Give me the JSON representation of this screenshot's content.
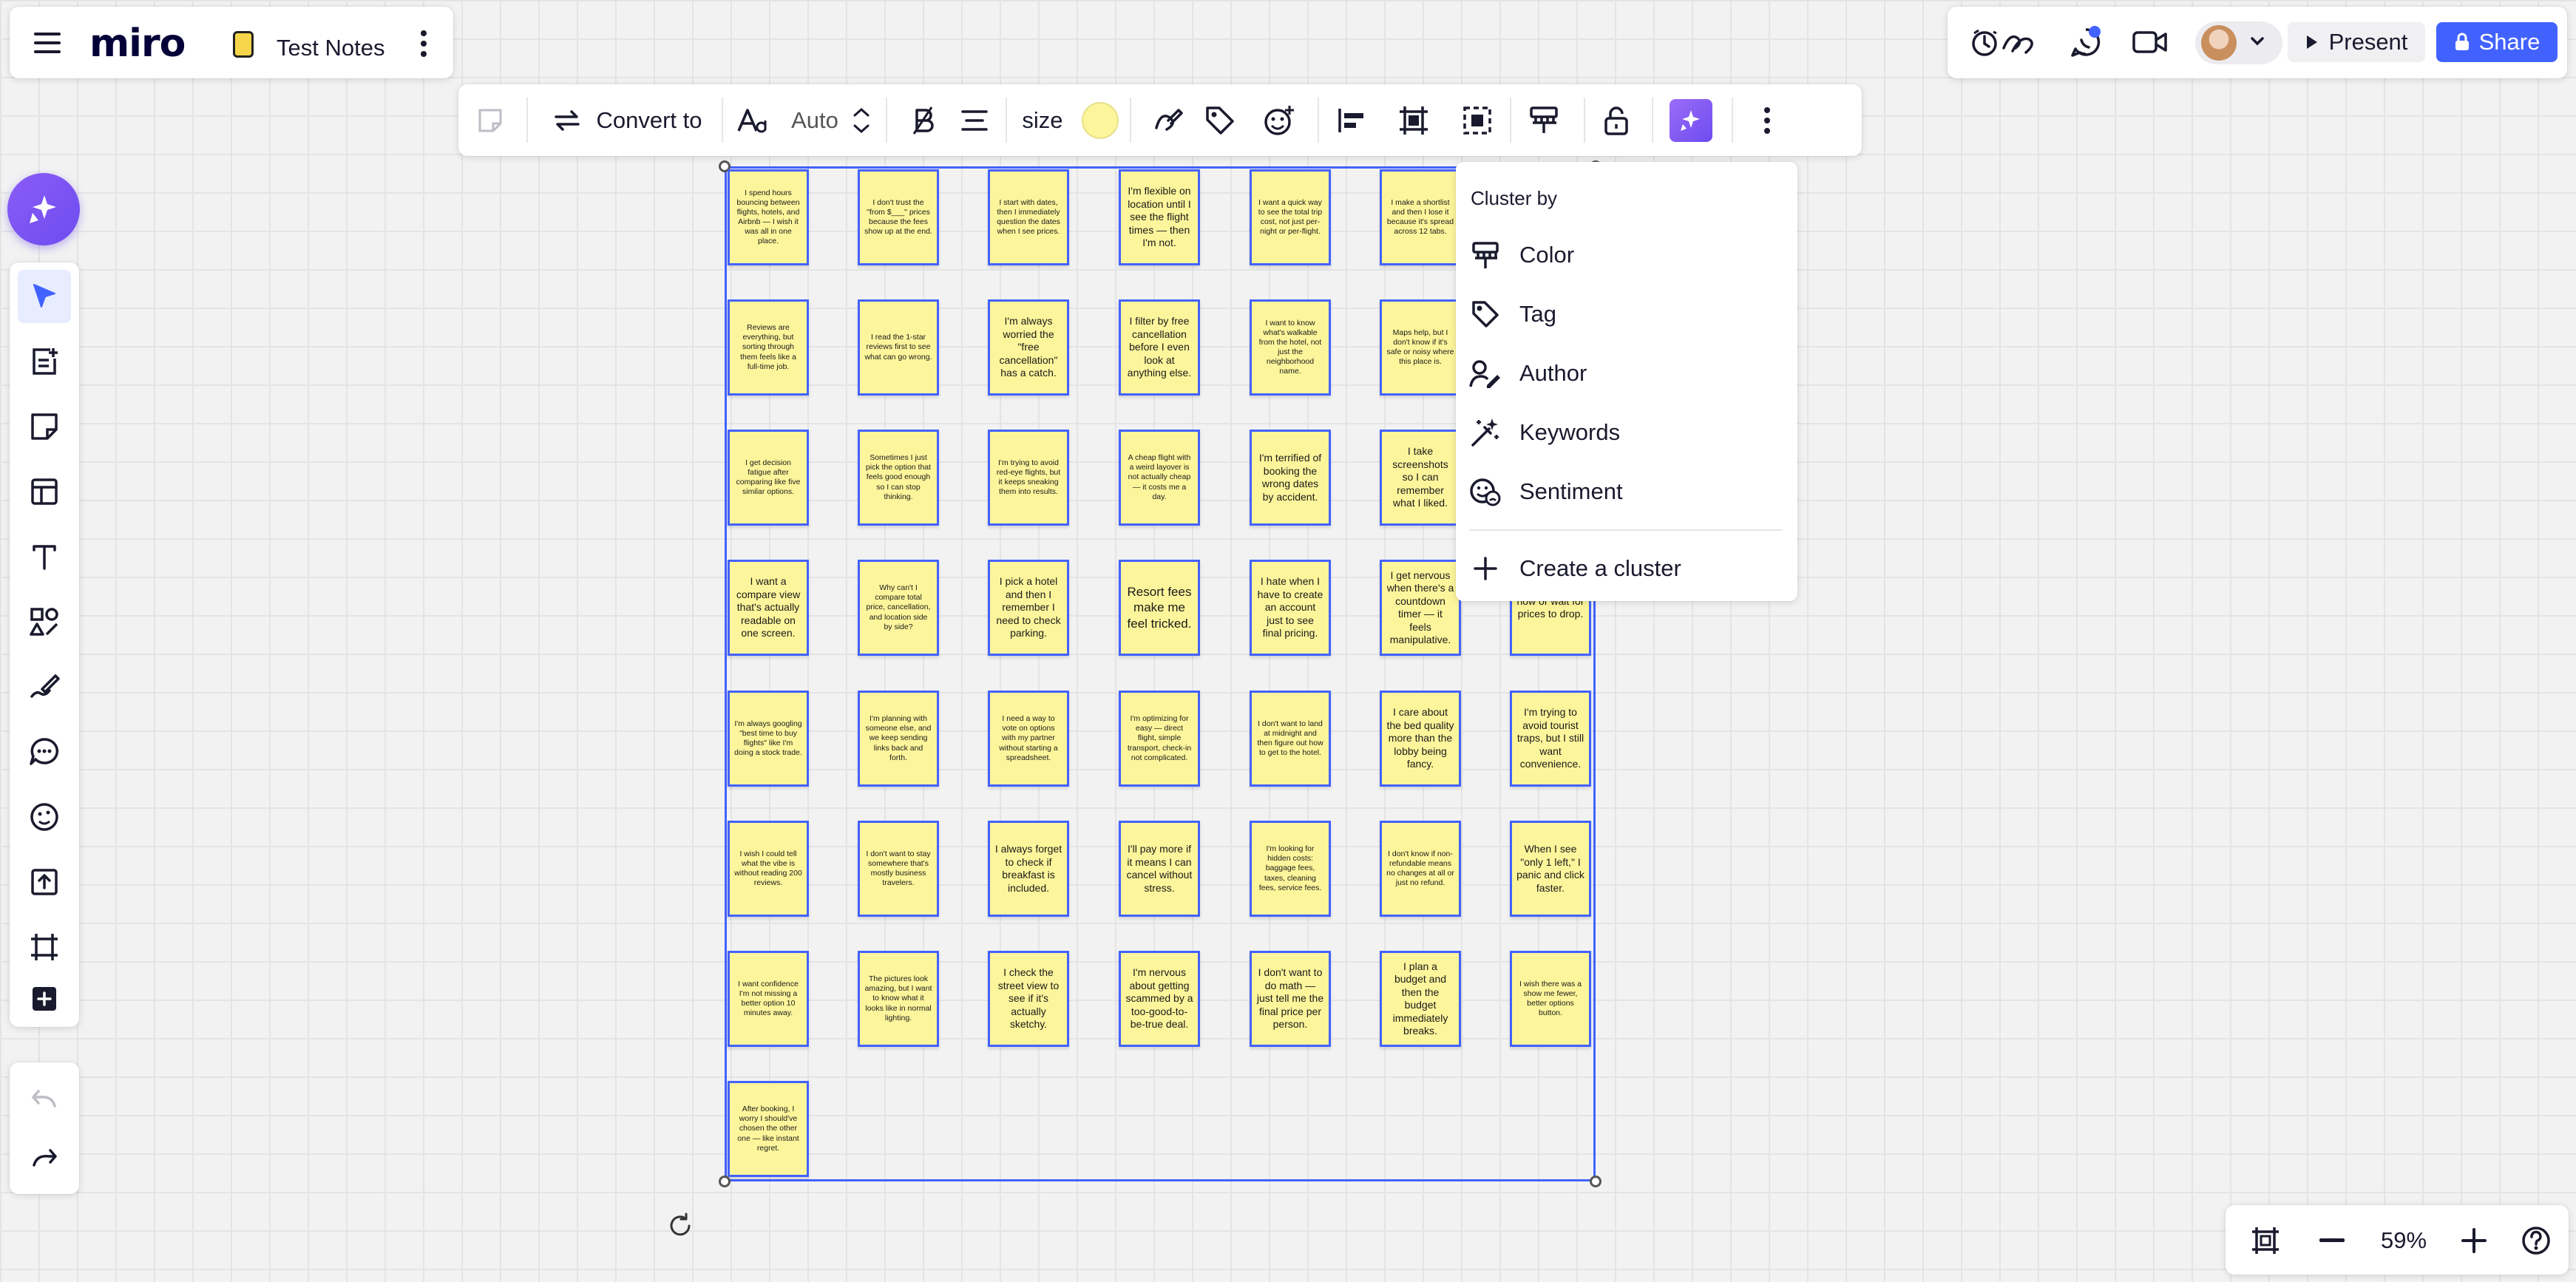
{
  "app": {
    "logo": "miro",
    "board_name": "Test Notes"
  },
  "toolbar": {
    "convert_label": "Convert to",
    "font_size": "Auto",
    "size_label": "size",
    "sticky_color": "#fdf59b"
  },
  "topbar": {
    "present_label": "Present",
    "share_label": "Share",
    "accent": "#4262ff"
  },
  "zoom": {
    "level": "59%"
  },
  "cluster_menu": {
    "title": "Cluster by",
    "items": [
      {
        "label": "Color",
        "icon": "paint-roller-icon"
      },
      {
        "label": "Tag",
        "icon": "tag-icon"
      },
      {
        "label": "Author",
        "icon": "author-icon"
      },
      {
        "label": "Keywords",
        "icon": "magic-wand-icon"
      },
      {
        "label": "Sentiment",
        "icon": "sentiment-icon"
      }
    ],
    "create_label": "Create a cluster"
  },
  "stickies": [
    "I spend hours bouncing between flights, hotels, and Airbnb — I wish it was all in one place.",
    "I don't trust the \"from $___\" prices because the fees show up at the end.",
    "I start with dates, then I immediately question the dates when I see prices.",
    "I'm flexible on location until I see the flight times — then I'm not.",
    "I want a quick way to see the total trip cost, not just per-night or per-flight.",
    "I make a shortlist and then I lose it because it's spread across 12 tabs.",
    "",
    "Reviews are everything, but sorting through them feels like a full-time job.",
    "I read the 1-star reviews first to see what can go wrong.",
    "I'm always worried the \"free cancellation\" has a catch.",
    "I filter by free cancellation before I even look at anything else.",
    "I want to know what's walkable from the hotel, not just the neighborhood name.",
    "Maps help, but I don't know if it's safe or noisy where this place is.",
    "",
    "I get decision fatigue after comparing like five similar options.",
    "Sometimes I just pick the option that feels good enough so I can stop thinking.",
    "I'm trying to avoid red-eye flights, but it keeps sneaking them into results.",
    "A cheap flight with a weird layover is not actually cheap — it costs me a day.",
    "I'm terrified of booking the wrong dates by accident.",
    "I take screenshots so I can remember what I liked.",
    "",
    "I want a compare view that's actually readable on one screen.",
    "Why can't I compare total price, cancellation, and location side by side?",
    "I pick a hotel and then I remember I need to check parking.",
    "Resort fees make me feel tricked.",
    "I hate when I have to create an account just to see final pricing.",
    "I get nervous when there's a countdown timer — it feels manipulative.",
    "now or wait for prices to drop.",
    "I'm always googling \"best time to buy flights\" like I'm doing a stock trade.",
    "I'm planning with someone else, and we keep sending links back and forth.",
    "I need a way to vote on options with my partner without starting a spreadsheet.",
    "I'm optimizing for easy — direct flight, simple transport, check-in not complicated.",
    "I don't want to land at midnight and then figure out how to get to the hotel.",
    "I care about the bed quality more than the lobby being fancy.",
    "I'm trying to avoid tourist traps, but I still want convenience.",
    "I wish I could tell what the vibe is without reading 200 reviews.",
    "I don't want to stay somewhere that's mostly business travelers.",
    "I always forget to check if breakfast is included.",
    "I'll pay more if it means I can cancel without stress.",
    "I'm looking for hidden costs: baggage fees, taxes, cleaning fees, service fees.",
    "I don't know if non-refundable means no changes at all or just no refund.",
    "When I see \"only 1 left,\" I panic and click faster.",
    "I want confidence I'm not missing a better option 10 minutes away.",
    "The pictures look amazing, but I want to know what it looks like in normal lighting.",
    "I check the street view to see if it's actually sketchy.",
    "I'm nervous about getting scammed by a too-good-to-be-true deal.",
    "I don't want to do math — just tell me the final price per person.",
    "I plan a budget and then the budget immediately breaks.",
    "I wish there was a show me fewer, better options button.",
    "After booking, I worry I should've chosen the other one — like instant regret."
  ]
}
